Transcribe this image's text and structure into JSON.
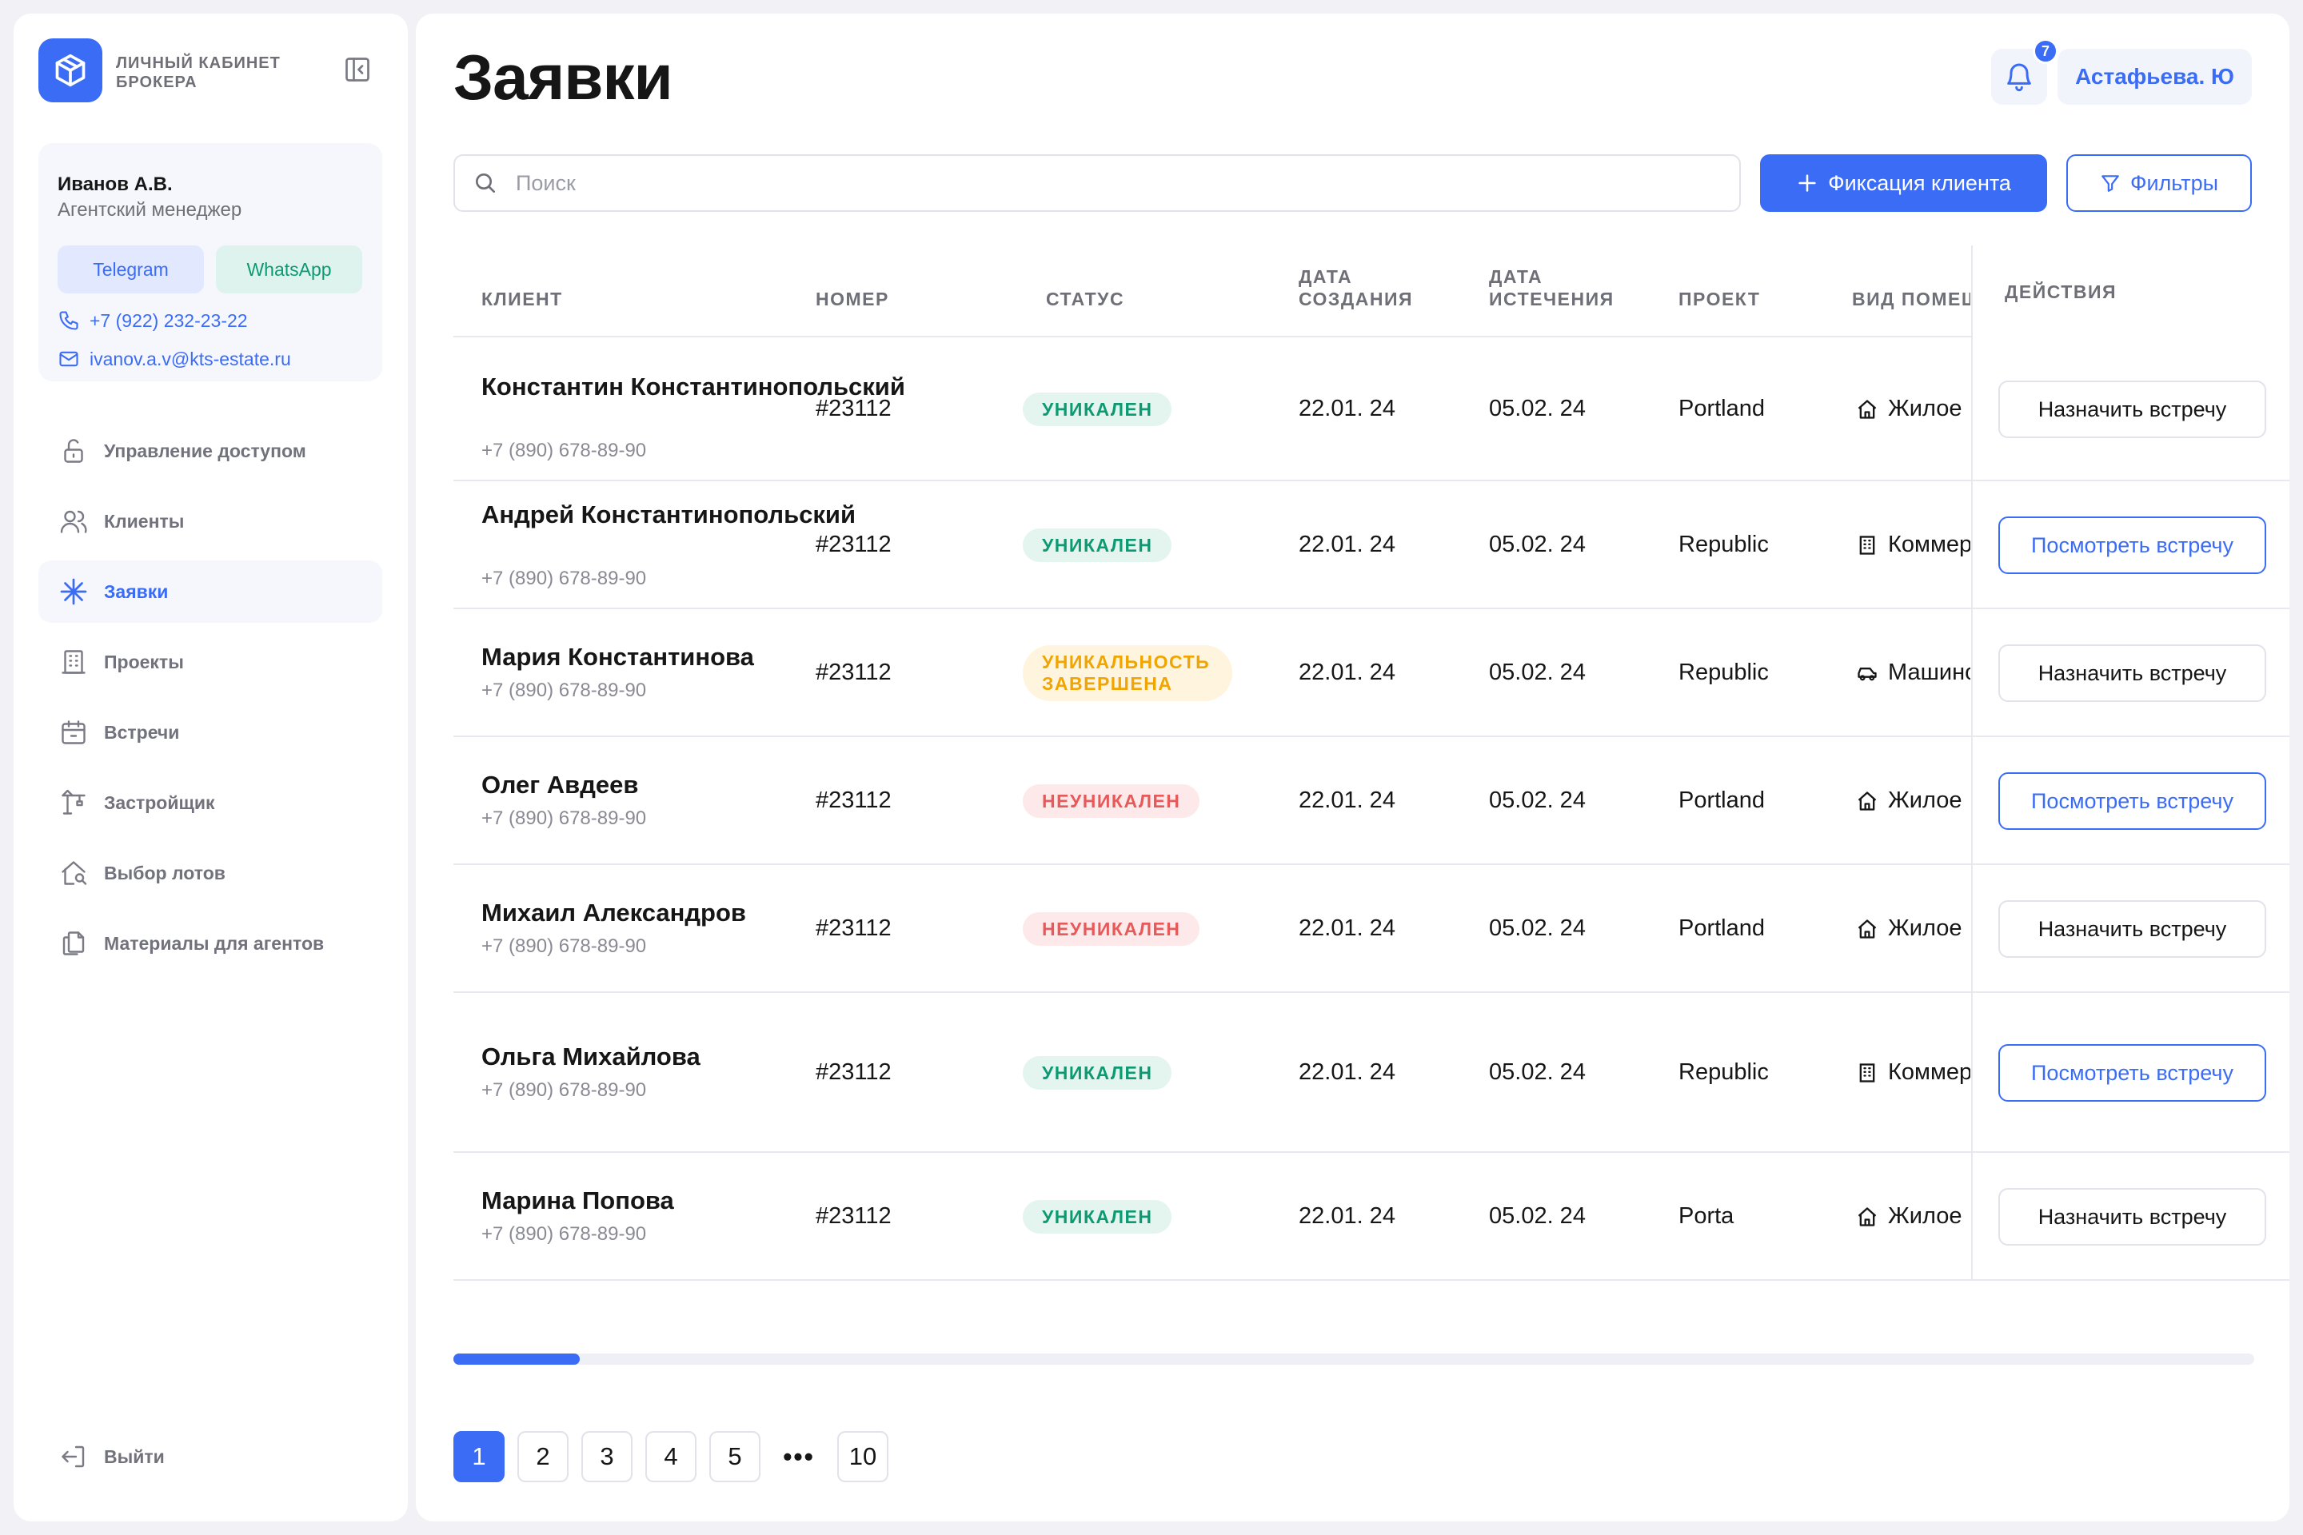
{
  "sidebar": {
    "brand": "ЛИЧНЫЙ КАБИНЕТ БРОКЕРА",
    "manager": {
      "name": "Иванов А.В.",
      "role": "Агентский менеджер",
      "telegram_label": "Telegram",
      "whatsapp_label": "WhatsApp",
      "phone": "+7 (922) 232-23-22",
      "email": "ivanov.a.v@kts-estate.ru"
    },
    "nav": [
      {
        "label": "Управление доступом",
        "icon": "lock-icon"
      },
      {
        "label": "Клиенты",
        "icon": "users-icon"
      },
      {
        "label": "Заявки",
        "icon": "sparkle-icon",
        "active": true
      },
      {
        "label": "Проекты",
        "icon": "building-icon"
      },
      {
        "label": "Встречи",
        "icon": "calendar-icon"
      },
      {
        "label": "Застройщик",
        "icon": "crane-icon"
      },
      {
        "label": "Выбор лотов",
        "icon": "house-search-icon"
      },
      {
        "label": "Материалы для агентов",
        "icon": "documents-icon"
      }
    ],
    "logout_label": "Выйти"
  },
  "header": {
    "title": "Заявки",
    "notifications_count": "7",
    "user_name": "Астафьева. Ю"
  },
  "toolbar": {
    "search_placeholder": "Поиск",
    "search_value": "",
    "add_client_label": "Фиксация клиента",
    "filters_label": "Фильтры"
  },
  "table": {
    "columns": {
      "client": "КЛИЕНТ",
      "number": "НОМЕР",
      "status": "СТАТУС",
      "created": "ДАТА СОЗДАНИЯ",
      "expires": "ДАТА ИСТЕЧЕНИЯ",
      "project": "ПРОЕКТ",
      "type": "ВИД ПОМЕЩЕНИЯ",
      "actions": "ДЕЙСТВИЯ"
    },
    "rows": [
      {
        "name": "Константин Константинопольский",
        "phone": "+7 (890) 678-89-90",
        "number": "#23112",
        "status": "УНИКАЛЕН",
        "status_kind": "uniq",
        "created": "22.01. 24",
        "expires": "05.02. 24",
        "project": "Portland",
        "type": "Жилое",
        "type_icon": "home-icon",
        "action": "Назначить встречу",
        "action_kind": "set"
      },
      {
        "name": "Андрей Константинопольский",
        "phone": "+7 (890) 678-89-90",
        "number": "#23112",
        "status": "УНИКАЛЕН",
        "status_kind": "uniq",
        "created": "22.01. 24",
        "expires": "05.02. 24",
        "project": "Republic",
        "type": "Коммерческое",
        "type_icon": "office-icon",
        "action": "Посмотреть встречу",
        "action_kind": "view"
      },
      {
        "name": "Мария Константинова",
        "phone": "+7 (890) 678-89-90",
        "number": "#23112",
        "status": "УНИКАЛЬНОСТЬ ЗАВЕРШЕНА",
        "status_kind": "ended",
        "created": "22.01. 24",
        "expires": "05.02. 24",
        "project": "Republic",
        "type": "Машиноместо",
        "type_icon": "car-icon",
        "action": "Назначить встречу",
        "action_kind": "set"
      },
      {
        "name": "Олег Авдеев",
        "phone": "+7 (890) 678-89-90",
        "number": "#23112",
        "status": "НЕУНИКАЛЕН",
        "status_kind": "nonuniq",
        "created": "22.01. 24",
        "expires": "05.02. 24",
        "project": "Portland",
        "type": "Жилое",
        "type_icon": "home-icon",
        "action": "Посмотреть встречу",
        "action_kind": "view"
      },
      {
        "name": "Михаил Александров",
        "phone": "+7 (890) 678-89-90",
        "number": "#23112",
        "status": "НЕУНИКАЛЕН",
        "status_kind": "nonuniq",
        "created": "22.01. 24",
        "expires": "05.02. 24",
        "project": "Portland",
        "type": "Жилое",
        "type_icon": "home-icon",
        "action": "Назначить встречу",
        "action_kind": "set"
      },
      {
        "name": "Ольга Михайлова",
        "phone": "+7 (890) 678-89-90",
        "number": "#23112",
        "status": "УНИКАЛЕН",
        "status_kind": "uniq",
        "created": "22.01. 24",
        "expires": "05.02. 24",
        "project": "Republic",
        "type": "Коммерческое",
        "type_icon": "office-icon",
        "action": "Посмотреть встречу",
        "action_kind": "view"
      },
      {
        "name": "Марина Попова",
        "phone": "+7 (890) 678-89-90",
        "number": "#23112",
        "status": "УНИКАЛЕН",
        "status_kind": "uniq",
        "created": "22.01. 24",
        "expires": "05.02. 24",
        "project": "Porta",
        "type": "Жилое",
        "type_icon": "home-icon",
        "action": "Назначить встречу",
        "action_kind": "set"
      }
    ]
  },
  "scroll": {
    "position": 0.07
  },
  "pagination": {
    "pages": [
      "1",
      "2",
      "3",
      "4",
      "5",
      "•••",
      "10"
    ],
    "current": "1"
  },
  "colors": {
    "accent": "#3b6cf6",
    "unique": "#0d9a72",
    "non_unique": "#e65a5a",
    "ended": "#f0a500"
  }
}
